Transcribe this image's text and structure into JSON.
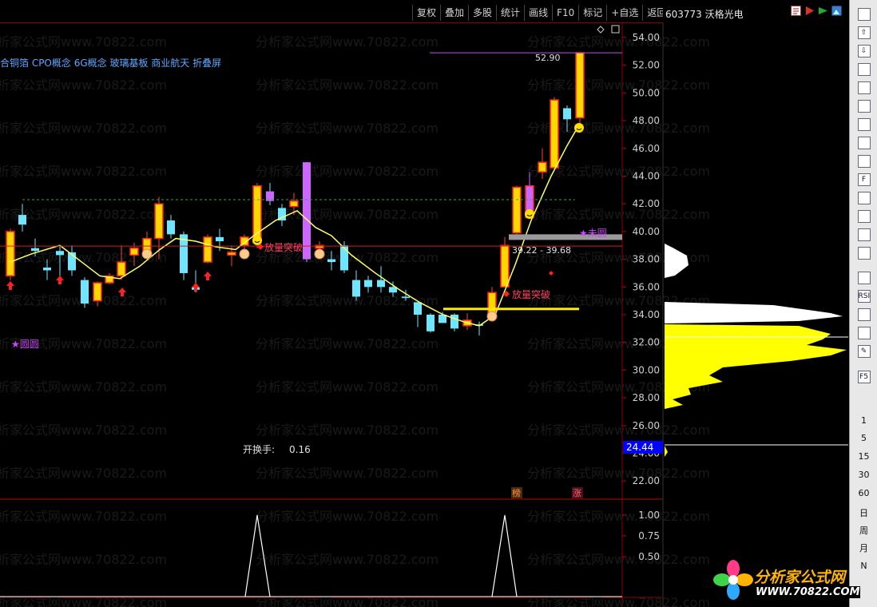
{
  "toolbar": {
    "buttons": [
      "复权",
      "叠加",
      "多股",
      "统计",
      "画线",
      "F10",
      "标记",
      "+自选",
      "返回"
    ]
  },
  "stock": {
    "title": "603773 沃格光电"
  },
  "concepts": "合铜箔 CPO概念 6G概念 玻璃基板 商业航天 折叠屏",
  "price_axis": {
    "labels": [
      "54.00",
      "52.00",
      "50.00",
      "48.00",
      "46.00",
      "44.00",
      "42.00",
      "40.00",
      "38.00",
      "36.00",
      "34.00",
      "32.00",
      "30.00",
      "28.00",
      "26.00",
      "24.00",
      "22.00"
    ],
    "current_price": "24.44"
  },
  "indicator_axis": {
    "labels": [
      "1.00",
      "0.75",
      "0.50"
    ]
  },
  "annotations": {
    "high_price": "52.90",
    "range_label": "39.22 - 39.68",
    "breakout_1": "放量突破",
    "breakout_2": "放量突破",
    "star_left": "★圆圆",
    "star_right": "★未圆",
    "turnover_label": "开换手:",
    "turnover_value": "0.16",
    "badge_list": "榜",
    "badge_limit": "涨"
  },
  "watermark": "分析家公式网www.70822.com",
  "side_tabs": [
    "1",
    "5",
    "15",
    "30",
    "60",
    "日",
    "周",
    "月",
    "N"
  ],
  "logo": {
    "cn": "分析家公式网",
    "url": "WWW.70822.COM"
  },
  "colors": {
    "up": "#ffd700",
    "down": "#6fe6ff",
    "ma": "#ffff66",
    "grid": "#8b0000"
  }
}
